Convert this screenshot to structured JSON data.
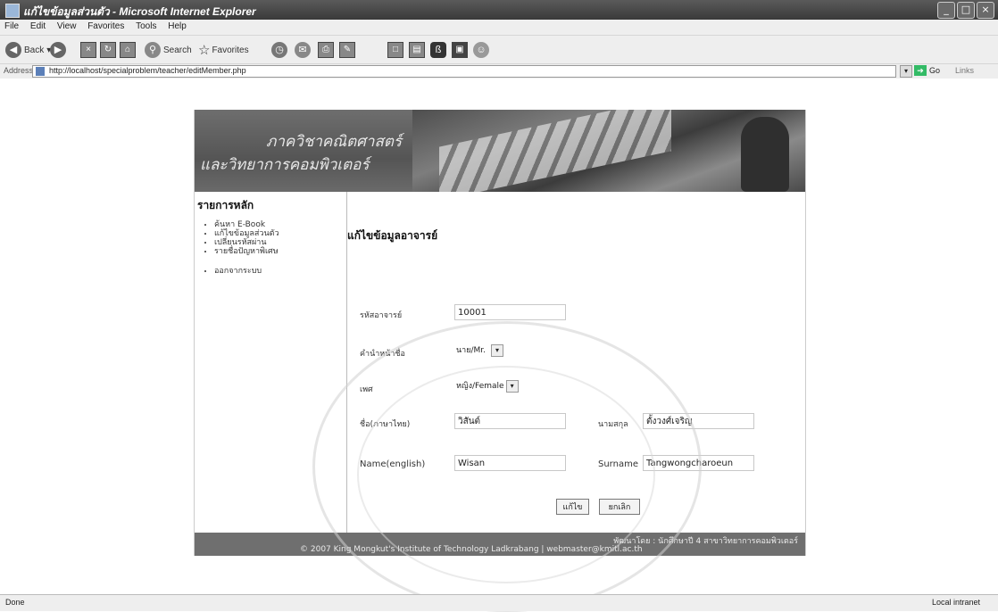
{
  "window": {
    "title": "แก้ไขข้อมูลส่วนตัว - Microsoft Internet Explorer"
  },
  "menubar": [
    "File",
    "Edit",
    "View",
    "Favorites",
    "Tools",
    "Help"
  ],
  "toolbar": {
    "back": "Back",
    "search": "Search",
    "favorites": "Favorites"
  },
  "addressbar": {
    "label": "Address",
    "url": "http://localhost/specialproblem/teacher/editMember.php",
    "go": "Go",
    "links": "Links"
  },
  "banner": {
    "line1": "ภาควิชาคณิตศาสตร์",
    "line2": "และวิทยาการคอมพิวเตอร์"
  },
  "sidebar": {
    "heading": "รายการหลัก",
    "items": [
      "ค้นหา E-Book",
      "แก้ไขข้อมูลส่วนตัว",
      "เปลี่ยนรหัสผ่าน",
      "รายชื่อปัญหาพิเศษ",
      "ออกจากระบบ"
    ]
  },
  "form": {
    "title": "แก้ไขข้อมูลอาจารย์",
    "id_label": "รหัสอาจารย์",
    "id_value": "10001",
    "prefix_label": "คำนำหน้าชื่อ",
    "prefix_value": "นาย/Mr.",
    "sex_label": "เพศ",
    "sex_value": "หญิง/Female",
    "name_th_label": "ชื่อ(ภาษาไทย)",
    "name_th_value": "วิสันต์",
    "surname_th_label": "นามสกุล",
    "surname_th_value": "ตั้งวงศ์เจริญ",
    "name_en_label": "Name(english)",
    "name_en_value": "Wisan",
    "surname_en_label": "Surname",
    "surname_en_value": "Tangwongcharoeun",
    "submit_label": "แก้ไข",
    "cancel_label": "ยกเลิก"
  },
  "footer": {
    "line1": "พัฒนาโดย : นักศึกษาปี 4 สาขาวิทยาการคอมพิวเตอร์",
    "line2": "© 2007 King Mongkut's Institute of Technology Ladkrabang | webmaster@kmitl.ac.th"
  },
  "statusbar": {
    "status": "Done",
    "zone": "Local intranet"
  }
}
